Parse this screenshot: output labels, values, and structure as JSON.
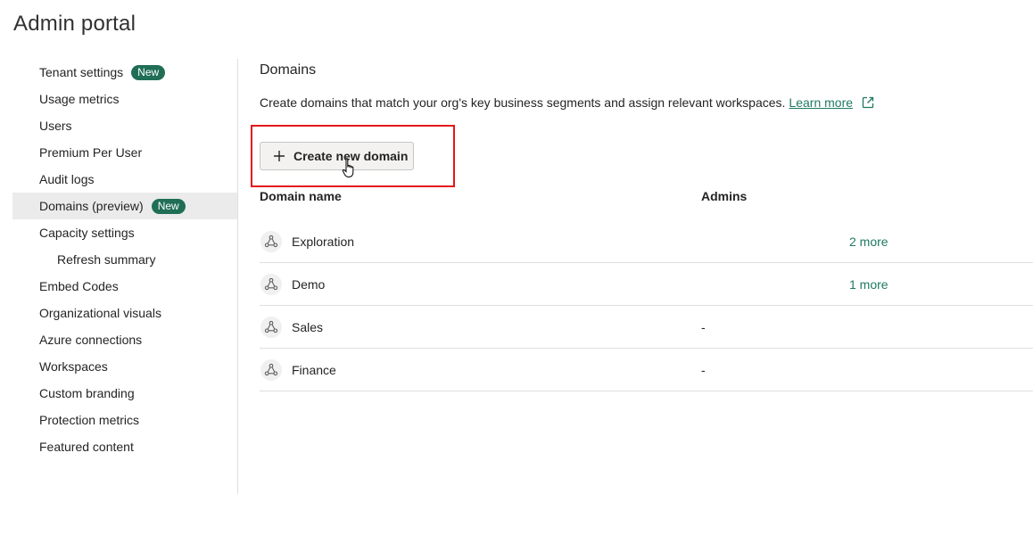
{
  "page": {
    "title": "Admin portal"
  },
  "sidebar": {
    "items": [
      {
        "label": "Tenant settings",
        "badge": "New"
      },
      {
        "label": "Usage metrics"
      },
      {
        "label": "Users"
      },
      {
        "label": "Premium Per User"
      },
      {
        "label": "Audit logs"
      },
      {
        "label": "Domains (preview)",
        "badge": "New",
        "active": true
      },
      {
        "label": "Capacity settings"
      },
      {
        "label": "Refresh summary",
        "sub": true
      },
      {
        "label": "Embed Codes"
      },
      {
        "label": "Organizational visuals"
      },
      {
        "label": "Azure connections"
      },
      {
        "label": "Workspaces"
      },
      {
        "label": "Custom branding"
      },
      {
        "label": "Protection metrics"
      },
      {
        "label": "Featured content"
      }
    ]
  },
  "main": {
    "title": "Domains",
    "description": "Create domains that match your org's key business segments and assign relevant workspaces.",
    "learn_more": "Learn more",
    "create_button": "Create new domain",
    "table": {
      "headers": {
        "name": "Domain name",
        "admins": "Admins"
      },
      "rows": [
        {
          "name": "Exploration",
          "admins": "",
          "more": "2 more"
        },
        {
          "name": "Demo",
          "admins": "",
          "more": "1 more"
        },
        {
          "name": "Sales",
          "admins": "-",
          "more": ""
        },
        {
          "name": "Finance",
          "admins": "-",
          "more": ""
        }
      ]
    }
  },
  "colors": {
    "accent": "#1f6e55",
    "link": "#1f7a62",
    "highlight": "#e3151a"
  },
  "icons": {
    "domain": "domain-icon",
    "external_link": "external-link-icon",
    "plus": "plus-icon",
    "cursor": "hand-cursor-icon"
  }
}
